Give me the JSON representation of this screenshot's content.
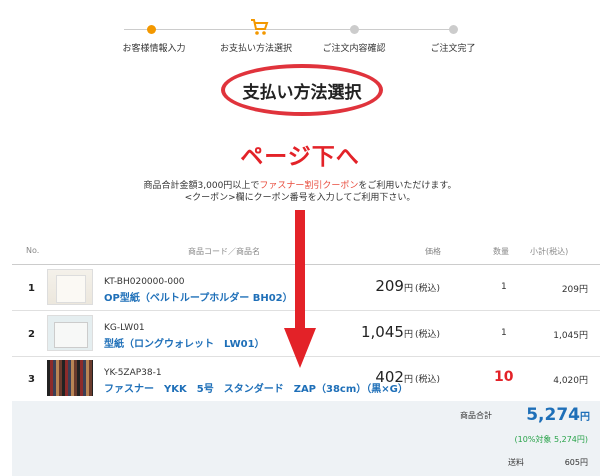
{
  "steps": [
    {
      "label": "お客様情報入力",
      "status": "done"
    },
    {
      "label": "お支払い方法選択",
      "status": "current"
    },
    {
      "label": "ご注文内容確認",
      "status": "todo"
    },
    {
      "label": "ご注文完了",
      "status": "todo"
    }
  ],
  "page_title": "支払い方法選択",
  "page_down_label": "ページ下へ",
  "notice": {
    "line1_before": "商品合計金額3,000円以上で",
    "line1_highlight": "ファスナー割引クーポン",
    "line1_after": "をご利用いただけます。",
    "line2": "<クーポン>欄にクーポン番号を入力してご利用下さい。"
  },
  "table": {
    "headers": {
      "no": "No.",
      "product": "商品コード／商品名",
      "price": "価格",
      "qty": "数量",
      "subtotal": "小計(税込)"
    },
    "rows": [
      {
        "no": "1",
        "code": "KT-BH020000-000",
        "name": "OP型紙（ベルトループホルダー BH02）",
        "price": "209",
        "yen": "円",
        "tax": "(税込)",
        "qty": "1",
        "subtotal": "209円"
      },
      {
        "no": "2",
        "code": "KG-LW01",
        "name": "型紙（ロングウォレット　LW01）",
        "price": "1,045",
        "yen": "円",
        "tax": "(税込)",
        "qty": "1",
        "subtotal": "1,045円"
      },
      {
        "no": "3",
        "code": "YK-5ZAP38-1",
        "name": "ファスナー　YKK　5号　スタンダード　ZAP（38cm）（黒×G）",
        "price": "402",
        "yen": "円",
        "tax": "(税込)",
        "qty": "10",
        "subtotal": "4,020円"
      }
    ]
  },
  "summary": {
    "total_label": "商品合計",
    "total_value": "5,274",
    "total_unit": "円",
    "tax_note": "(10%対象 5,274円)",
    "shipping_label": "送料",
    "shipping_value": "605円"
  },
  "colors": {
    "accent_orange": "#f39800",
    "alert_red": "#e32228",
    "link_blue": "#1e6fb8",
    "tax_green": "#29a34a"
  }
}
